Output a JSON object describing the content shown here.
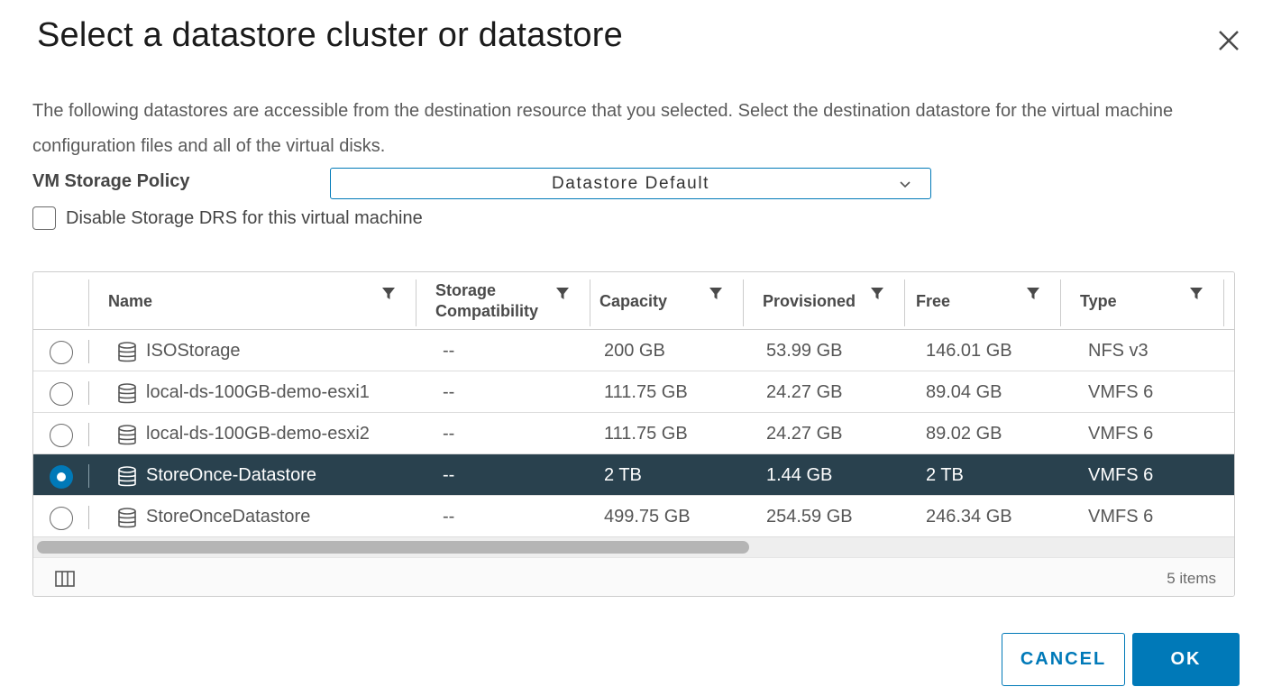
{
  "dialog": {
    "title": "Select a datastore cluster or datastore",
    "description": "The following datastores are accessible from the destination resource that you selected. Select the destination datastore for the virtual machine configuration files and all of the virtual disks."
  },
  "policy": {
    "label": "VM Storage Policy",
    "value": "Datastore Default"
  },
  "drs": {
    "label": "Disable Storage DRS for this virtual machine",
    "checked": false
  },
  "table": {
    "columns": [
      "Name",
      "Storage Compatibility",
      "Capacity",
      "Provisioned",
      "Free",
      "Type"
    ],
    "rows": [
      {
        "name": "ISOStorage",
        "compat": "--",
        "capacity": "200 GB",
        "provisioned": "53.99 GB",
        "free": "146.01 GB",
        "type": "NFS v3",
        "selected": false
      },
      {
        "name": "local-ds-100GB-demo-esxi1",
        "compat": "--",
        "capacity": "111.75 GB",
        "provisioned": "24.27 GB",
        "free": "89.04 GB",
        "type": "VMFS 6",
        "selected": false
      },
      {
        "name": "local-ds-100GB-demo-esxi2",
        "compat": "--",
        "capacity": "111.75 GB",
        "provisioned": "24.27 GB",
        "free": "89.02 GB",
        "type": "VMFS 6",
        "selected": false
      },
      {
        "name": "StoreOnce-Datastore",
        "compat": "--",
        "capacity": "2 TB",
        "provisioned": "1.44 GB",
        "free": "2 TB",
        "type": "VMFS 6",
        "selected": true
      },
      {
        "name": "StoreOnceDatastore",
        "compat": "--",
        "capacity": "499.75 GB",
        "provisioned": "254.59 GB",
        "free": "246.34 GB",
        "type": "VMFS 6",
        "selected": false
      }
    ],
    "footer_count": "5 items"
  },
  "buttons": {
    "cancel": "CANCEL",
    "ok": "OK"
  },
  "colors": {
    "accent": "#0079b8",
    "selected_row": "#29414e"
  },
  "icons": [
    "close-icon",
    "chevron-down-icon",
    "filter-icon",
    "datastore-icon",
    "column-toggle-icon"
  ]
}
